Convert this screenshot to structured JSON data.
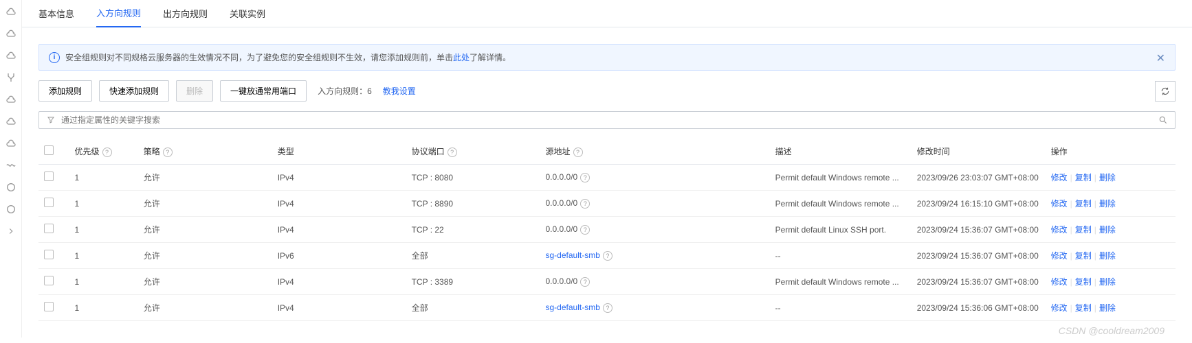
{
  "tabs": [
    "基本信息",
    "入方向规则",
    "出方向规则",
    "关联实例"
  ],
  "activeTab": 1,
  "alert": {
    "prefix": "安全组规则对不同规格云服务器的生效情况不同，为了避免您的安全组规则不生效，请您添加规则前，单击",
    "link": "此处",
    "suffix": "了解详情。"
  },
  "toolbar": {
    "addRule": "添加规则",
    "quickAdd": "快速添加规则",
    "delete": "删除",
    "openPorts": "一键放通常用端口",
    "countLabel": "入方向规则：6",
    "tutorial": "教我设置"
  },
  "search": {
    "placeholder": "通过指定属性的关键字搜索"
  },
  "headers": {
    "priority": "优先级",
    "strategy": "策略",
    "type": "类型",
    "protocolPort": "协议端口",
    "source": "源地址",
    "description": "描述",
    "modifyTime": "修改时间",
    "actions": "操作"
  },
  "actions": {
    "modify": "修改",
    "copy": "复制",
    "delete": "删除"
  },
  "rows": [
    {
      "priority": "1",
      "strategy": "允许",
      "type": "IPv4",
      "protocolPort": "TCP : 8080",
      "source": "0.0.0.0/0",
      "sourceIsLink": false,
      "description": "Permit default Windows remote ...",
      "modifyTime": "2023/09/26 23:03:07 GMT+08:00"
    },
    {
      "priority": "1",
      "strategy": "允许",
      "type": "IPv4",
      "protocolPort": "TCP : 8890",
      "source": "0.0.0.0/0",
      "sourceIsLink": false,
      "description": "Permit default Windows remote ...",
      "modifyTime": "2023/09/24 16:15:10 GMT+08:00"
    },
    {
      "priority": "1",
      "strategy": "允许",
      "type": "IPv4",
      "protocolPort": "TCP : 22",
      "source": "0.0.0.0/0",
      "sourceIsLink": false,
      "description": "Permit default Linux SSH port.",
      "modifyTime": "2023/09/24 15:36:07 GMT+08:00"
    },
    {
      "priority": "1",
      "strategy": "允许",
      "type": "IPv6",
      "protocolPort": "全部",
      "source": "sg-default-smb",
      "sourceIsLink": true,
      "description": "--",
      "modifyTime": "2023/09/24 15:36:07 GMT+08:00"
    },
    {
      "priority": "1",
      "strategy": "允许",
      "type": "IPv4",
      "protocolPort": "TCP : 3389",
      "source": "0.0.0.0/0",
      "sourceIsLink": false,
      "description": "Permit default Windows remote ...",
      "modifyTime": "2023/09/24 15:36:07 GMT+08:00"
    },
    {
      "priority": "1",
      "strategy": "允许",
      "type": "IPv4",
      "protocolPort": "全部",
      "source": "sg-default-smb",
      "sourceIsLink": true,
      "description": "--",
      "modifyTime": "2023/09/24 15:36:06 GMT+08:00"
    }
  ],
  "watermark": "CSDN @cooldream2009"
}
